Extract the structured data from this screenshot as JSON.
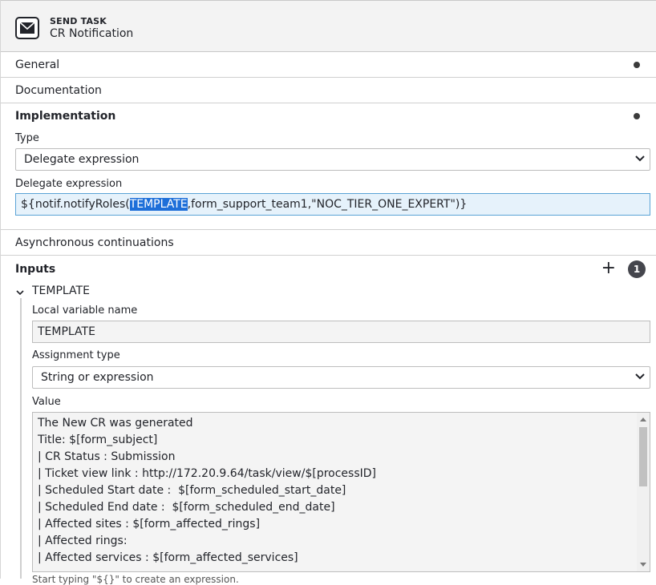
{
  "header": {
    "kind": "SEND TASK",
    "name": "CR Notification",
    "icon": "envelope-icon"
  },
  "sections": {
    "general": "General",
    "documentation": "Documentation",
    "implementation": "Implementation",
    "async": "Asynchronous continuations",
    "inputs": "Inputs"
  },
  "implementation": {
    "type_label": "Type",
    "type_value": "Delegate expression",
    "delegate_label": "Delegate expression",
    "delegate_prefix": "${notif.notifyRoles(",
    "delegate_selected": "TEMPLATE",
    "delegate_suffix": ",form_support_team1,\"NOC_TIER_ONE_EXPERT\")}"
  },
  "inputs": {
    "count": "1",
    "item_title": "TEMPLATE",
    "local_var_label": "Local variable name",
    "local_var_value": "TEMPLATE",
    "assign_label": "Assignment type",
    "assign_value": "String or expression",
    "value_label": "Value",
    "value_lines": [
      "The New CR was generated",
      "Title: $[form_subject]",
      "| CR Status : Submission",
      "| Ticket view link : http://172.20.9.64/task/view/$[processID]",
      "| Scheduled Start date :  $[form_scheduled_start_date]",
      "| Scheduled End date :  $[form_scheduled_end_date]",
      "| Affected sites : $[form_affected_rings]",
      "| Affected rings:",
      "| Affected services : $[form_affected_services]"
    ],
    "hint": "Start typing \"${}\" to create an expression."
  }
}
